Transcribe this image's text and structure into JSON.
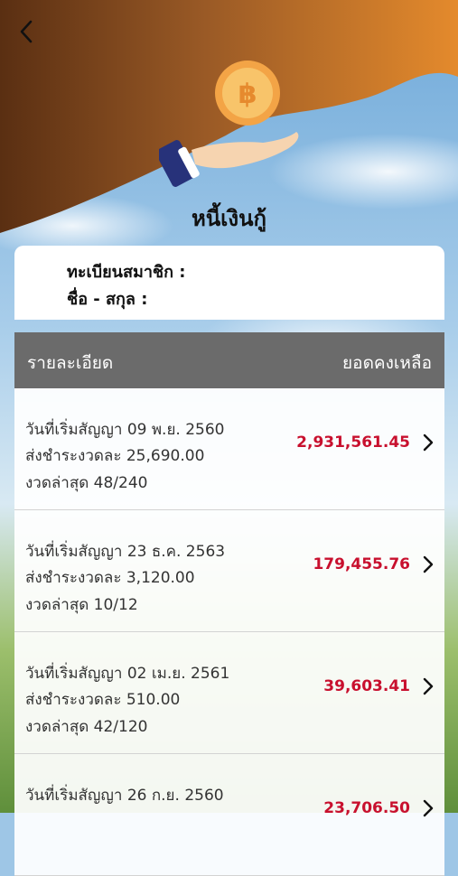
{
  "header": {
    "title": "หนี้เงินกู้",
    "coin_symbol": "฿",
    "colors": {
      "wave_dark": "#5a2f12",
      "wave_light": "#e48a2c",
      "coin": "#f6b24a"
    }
  },
  "member": {
    "registration_label": "ทะเบียนสมาชิก :",
    "name_label": "ชื่อ - สกุล :"
  },
  "table": {
    "col_detail": "รายละเอียด",
    "col_balance": "ยอดคงเหลือ",
    "rows": [
      {
        "start": "วันที่เริ่มสัญญา 09 พ.ย. 2560",
        "installment": "ส่งชำระงวดละ 25,690.00",
        "latest": "งวดล่าสุด 48/240",
        "balance": "2,931,561.45"
      },
      {
        "start": "วันที่เริ่มสัญญา 23 ธ.ค. 2563",
        "installment": "ส่งชำระงวดละ 3,120.00",
        "latest": "งวดล่าสุด 10/12",
        "balance": "179,455.76"
      },
      {
        "start": "วันที่เริ่มสัญญา 02 เม.ย. 2561",
        "installment": "ส่งชำระงวดละ 510.00",
        "latest": "งวดล่าสุด 42/120",
        "balance": "39,603.41"
      },
      {
        "start": "วันที่เริ่มสัญญา 26 ก.ย. 2560",
        "installment": "",
        "latest": "",
        "balance": "23,706.50"
      }
    ]
  }
}
